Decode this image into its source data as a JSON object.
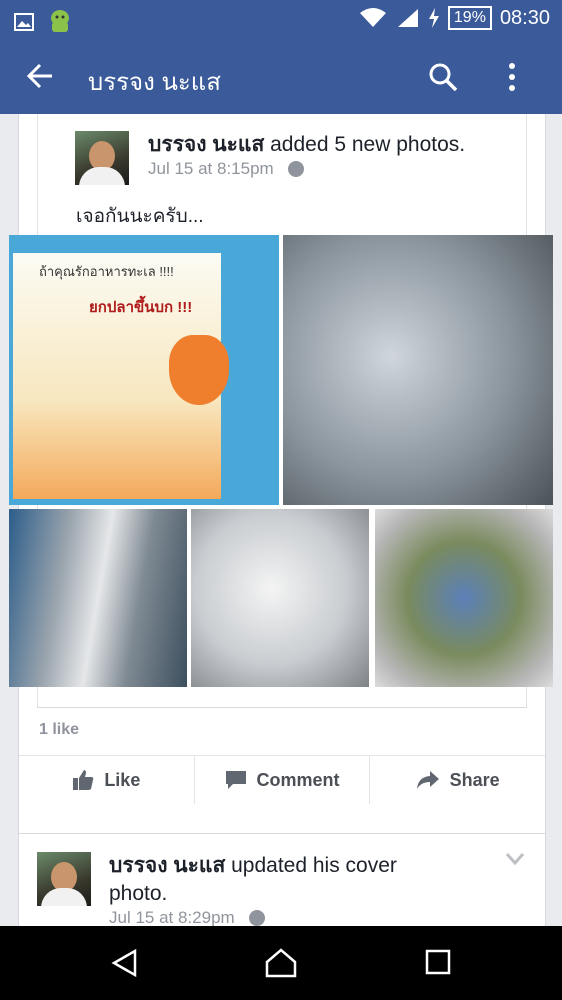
{
  "status_bar": {
    "battery": "19%",
    "time": "08:30"
  },
  "app_bar": {
    "title": "บรรจง นะแส"
  },
  "post1": {
    "author": "บรรจง นะแส",
    "action": " added 5 new photos.",
    "time": "Jul 15 at 8:15pm",
    "caption": "เจอกันนะครับ...",
    "poster_line1": "ถ้าคุณรักอาหารทะเล !!!!",
    "poster_line2": "ยกปลาขึ้นบก !!!",
    "likes": "1 like",
    "actions": {
      "like": "Like",
      "comment": "Comment",
      "share": "Share"
    }
  },
  "post2": {
    "author": "บรรจง นะแส",
    "action_line1": " updated his cover",
    "action_line2": "photo.",
    "time": "Jul 15 at 8:29pm"
  },
  "colors": {
    "brand": "#3b5a9a",
    "background": "#e9ebee"
  }
}
